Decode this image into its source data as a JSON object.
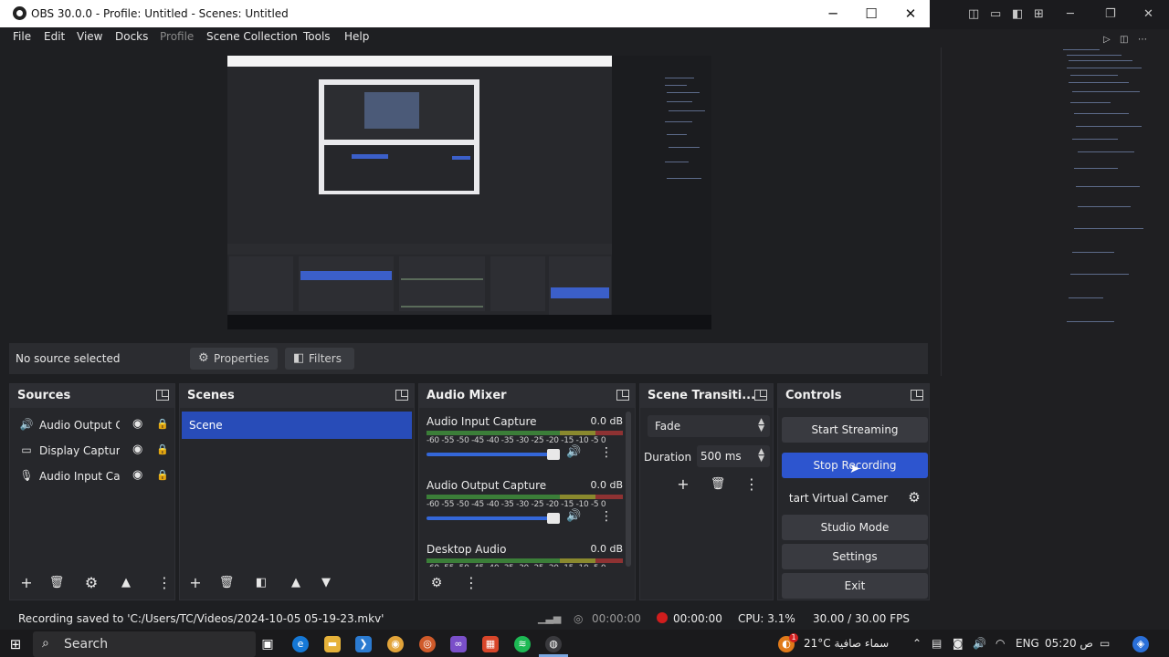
{
  "window": {
    "title": "OBS 30.0.0 - Profile: Untitled - Scenes: Untitled",
    "minimize": "─",
    "maximize": "☐",
    "close": "✕"
  },
  "menu": [
    "File",
    "Edit",
    "View",
    "Docks",
    "Profile",
    "Scene Collection",
    "Tools",
    "Help"
  ],
  "sourcebar": {
    "no_source": "No source selected",
    "properties": "Properties",
    "filters": "Filters"
  },
  "sources": {
    "title": "Sources",
    "items": [
      "Audio Output C",
      "Display Capture",
      "Audio Input Ca"
    ]
  },
  "scenes": {
    "title": "Scenes",
    "items": [
      "Scene"
    ]
  },
  "mixer": {
    "title": "Audio Mixer",
    "ticks": "-60 -55 -50 -45 -40 -35 -30 -25 -20 -15 -10 -5  0",
    "channels": [
      {
        "name": "Audio Input Capture",
        "db": "0.0 dB"
      },
      {
        "name": "Audio Output Capture",
        "db": "0.0 dB"
      },
      {
        "name": "Desktop Audio",
        "db": "0.0 dB"
      }
    ]
  },
  "transitions": {
    "title": "Scene Transiti...",
    "selected": "Fade",
    "duration_label": "Duration",
    "duration_value": "500 ms"
  },
  "controls": {
    "title": "Controls",
    "start_streaming": "Start Streaming",
    "stop_recording": "Stop Recording",
    "virtual_camera": "tart Virtual Camer",
    "studio_mode": "Studio Mode",
    "settings": "Settings",
    "exit": "Exit"
  },
  "status": {
    "message": "Recording saved to 'C:/Users/TC/Videos/2024-10-05 05-19-23.mkv'",
    "stream_time": "00:00:00",
    "rec_time": "00:00:00",
    "cpu": "CPU: 3.1%",
    "fps": "30.00 / 30.00 FPS"
  },
  "taskbar": {
    "search": "Search",
    "weather": "21°C  سماء صافية",
    "lang": "ENG",
    "time": "05:20 ص",
    "weather_badge": "1"
  },
  "colors": {
    "accent": "#2d55cf",
    "scene_selected": "#284cb8",
    "record": "#d01d1d"
  }
}
